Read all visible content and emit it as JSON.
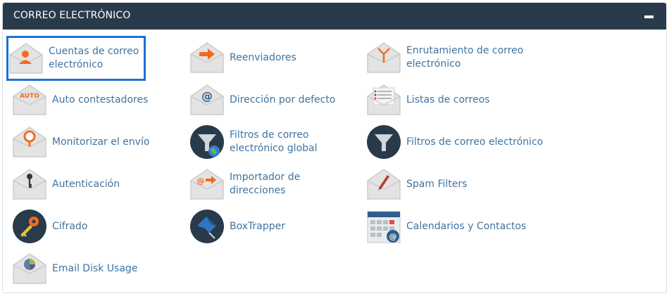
{
  "panel": {
    "title": "CORREO ELECTRÓNICO"
  },
  "items": [
    {
      "label": "Cuentas de correo electrónico",
      "icon": "email-accounts-icon"
    },
    {
      "label": "Reenviadores",
      "icon": "forwarders-icon"
    },
    {
      "label": "Enrutamiento de correo electrónico",
      "icon": "email-routing-icon"
    },
    {
      "label": "Auto contestadores",
      "icon": "autoresponders-icon",
      "badge": "AUTO"
    },
    {
      "label": "Dirección por defecto",
      "icon": "default-address-icon"
    },
    {
      "label": "Listas de correos",
      "icon": "mailing-lists-icon"
    },
    {
      "label": "Monitorizar el envío",
      "icon": "track-delivery-icon"
    },
    {
      "label": "Filtros de correo electrónico global",
      "icon": "global-email-filters-icon"
    },
    {
      "label": "Filtros de correo electrónico",
      "icon": "email-filters-icon"
    },
    {
      "label": "Autenticación",
      "icon": "authentication-icon"
    },
    {
      "label": "Importador de direcciones",
      "icon": "address-importer-icon"
    },
    {
      "label": "Spam Filters",
      "icon": "spam-filters-icon"
    },
    {
      "label": "Cifrado",
      "icon": "encryption-icon"
    },
    {
      "label": "BoxTrapper",
      "icon": "boxtrapper-icon"
    },
    {
      "label": "Calendarios y Contactos",
      "icon": "calendars-contacts-icon"
    },
    {
      "label": "Email Disk Usage",
      "icon": "email-disk-usage-icon"
    }
  ],
  "colors": {
    "header": "#293a4a",
    "link": "#3f73a0",
    "accent": "#f26a22",
    "selected_outline": "#1a73d6"
  }
}
